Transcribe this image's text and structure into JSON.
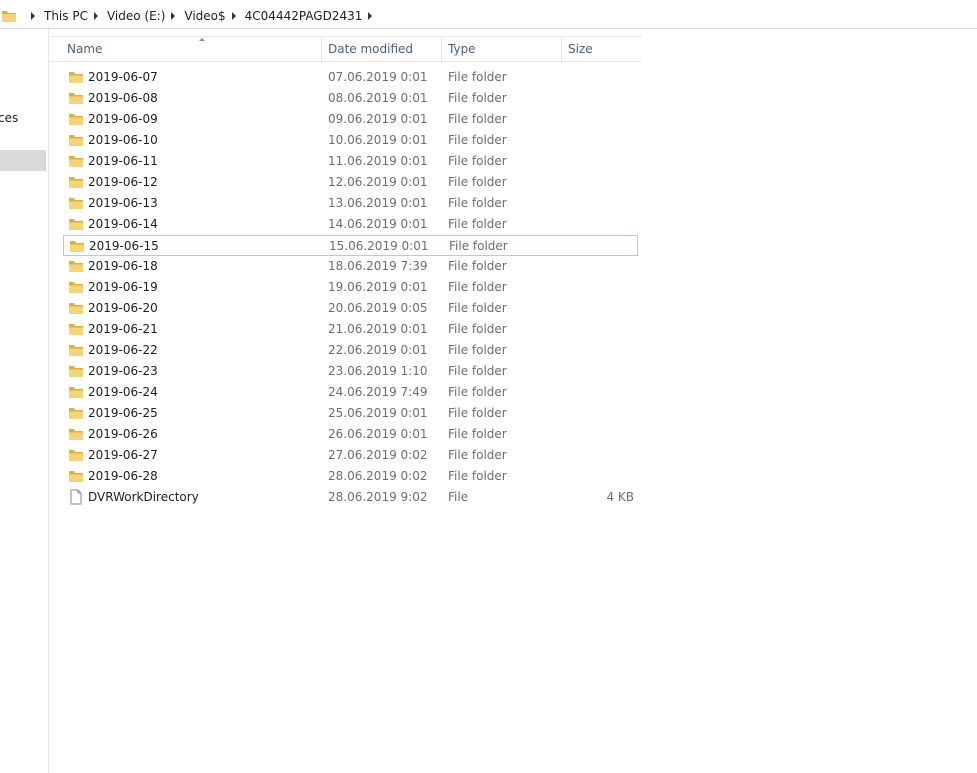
{
  "breadcrumb": [
    "This PC",
    "Video (E:)",
    "Video$",
    "4C04442PAGD2431"
  ],
  "nav": {
    "partial_label": "ces"
  },
  "columns": {
    "name": "Name",
    "date": "Date modified",
    "type": "Type",
    "size": "Size"
  },
  "rows": [
    {
      "name": "2019-06-07",
      "date": "07.06.2019 0:01",
      "type": "File folder",
      "size": "",
      "icon": "folder-icon"
    },
    {
      "name": "2019-06-08",
      "date": "08.06.2019 0:01",
      "type": "File folder",
      "size": "",
      "icon": "folder-icon"
    },
    {
      "name": "2019-06-09",
      "date": "09.06.2019 0:01",
      "type": "File folder",
      "size": "",
      "icon": "folder-icon"
    },
    {
      "name": "2019-06-10",
      "date": "10.06.2019 0:01",
      "type": "File folder",
      "size": "",
      "icon": "folder-icon"
    },
    {
      "name": "2019-06-11",
      "date": "11.06.2019 0:01",
      "type": "File folder",
      "size": "",
      "icon": "folder-icon"
    },
    {
      "name": "2019-06-12",
      "date": "12.06.2019 0:01",
      "type": "File folder",
      "size": "",
      "icon": "folder-icon"
    },
    {
      "name": "2019-06-13",
      "date": "13.06.2019 0:01",
      "type": "File folder",
      "size": "",
      "icon": "folder-icon"
    },
    {
      "name": "2019-06-14",
      "date": "14.06.2019 0:01",
      "type": "File folder",
      "size": "",
      "icon": "folder-icon"
    },
    {
      "name": "2019-06-15",
      "date": "15.06.2019 0:01",
      "type": "File folder",
      "size": "",
      "icon": "folder-icon"
    },
    {
      "name": "2019-06-18",
      "date": "18.06.2019 7:39",
      "type": "File folder",
      "size": "",
      "icon": "folder-icon"
    },
    {
      "name": "2019-06-19",
      "date": "19.06.2019 0:01",
      "type": "File folder",
      "size": "",
      "icon": "folder-icon"
    },
    {
      "name": "2019-06-20",
      "date": "20.06.2019 0:05",
      "type": "File folder",
      "size": "",
      "icon": "folder-icon"
    },
    {
      "name": "2019-06-21",
      "date": "21.06.2019 0:01",
      "type": "File folder",
      "size": "",
      "icon": "folder-icon"
    },
    {
      "name": "2019-06-22",
      "date": "22.06.2019 0:01",
      "type": "File folder",
      "size": "",
      "icon": "folder-icon"
    },
    {
      "name": "2019-06-23",
      "date": "23.06.2019 1:10",
      "type": "File folder",
      "size": "",
      "icon": "folder-icon"
    },
    {
      "name": "2019-06-24",
      "date": "24.06.2019 7:49",
      "type": "File folder",
      "size": "",
      "icon": "folder-icon"
    },
    {
      "name": "2019-06-25",
      "date": "25.06.2019 0:01",
      "type": "File folder",
      "size": "",
      "icon": "folder-icon"
    },
    {
      "name": "2019-06-26",
      "date": "26.06.2019 0:01",
      "type": "File folder",
      "size": "",
      "icon": "folder-icon"
    },
    {
      "name": "2019-06-27",
      "date": "27.06.2019 0:02",
      "type": "File folder",
      "size": "",
      "icon": "folder-icon"
    },
    {
      "name": "2019-06-28",
      "date": "28.06.2019 0:02",
      "type": "File folder",
      "size": "",
      "icon": "folder-icon"
    },
    {
      "name": "DVRWorkDirectory",
      "date": "28.06.2019 9:02",
      "type": "File",
      "size": "4 KB",
      "icon": "file-icon"
    }
  ],
  "focused_row": "2019-06-15",
  "colors": {
    "focus_border": "#99d1ff",
    "header_text": "#4c607a",
    "folder_yellow": "#e8c25a"
  }
}
